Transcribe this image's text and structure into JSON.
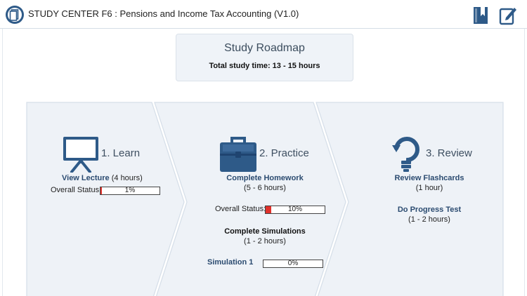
{
  "header": {
    "title": "STUDY CENTER F6 : Pensions and Income Tax Accounting (V1.0)",
    "logo_icon": "document-circle-icon",
    "bookmark_icon": "bookmark-icon",
    "notes_icon": "edit-note-icon"
  },
  "roadmap": {
    "title": "Study Roadmap",
    "total_time": "Total study time: 13 - 15 hours"
  },
  "colors": {
    "panel_bg": "#eef2f7",
    "panel_border": "#d5dee8",
    "link": "#2b4b70",
    "icon_blue": "#2e5a88",
    "progress_fill": "#e0312b"
  },
  "learn": {
    "title": "1. Learn",
    "icon": "presentation-screen-icon",
    "view_lecture_link": "View Lecture",
    "view_lecture_hours": " (4 hours)",
    "status_label": "Overall Status:",
    "status_percent": "1%",
    "status_value": 1
  },
  "practice": {
    "title": "2. Practice",
    "icon": "briefcase-icon",
    "homework_link": "Complete Homework",
    "homework_hours": "(5 - 6 hours)",
    "status_label": "Overall Status:",
    "status_percent": "10%",
    "status_value": 10,
    "simulations_heading": "Complete Simulations",
    "simulations_hours": "(1 - 2 hours)",
    "simulation_link": "Simulation 1",
    "simulation_percent": "0%",
    "simulation_value": 0
  },
  "review": {
    "title": "3. Review",
    "icon": "refresh-bulb-icon",
    "flashcards_link": "Review Flashcards",
    "flashcards_hours": "(1 hour)",
    "progress_test_link": "Do Progress Test",
    "progress_test_hours": "(1 - 2 hours)"
  }
}
